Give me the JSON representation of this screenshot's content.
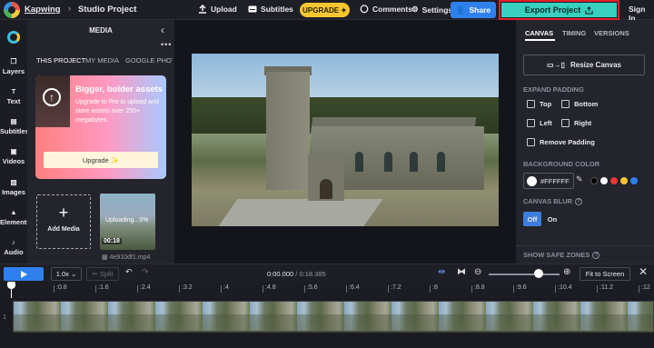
{
  "header": {
    "brand": "Kapwing",
    "project_name": "Studio Project",
    "upload": "Upload",
    "subtitles": "Subtitles",
    "upgrade": "UPGRADE",
    "comments": "Comments",
    "settings": "Settings",
    "share": "Share",
    "export": "Export Project",
    "signin": "Sign In"
  },
  "leftnav": {
    "items": [
      {
        "label": "Layers",
        "icon": "layers-icon"
      },
      {
        "label": "Text",
        "icon": "text-icon"
      },
      {
        "label": "Subtitles",
        "icon": "subtitles-icon"
      },
      {
        "label": "Videos",
        "icon": "videos-icon"
      },
      {
        "label": "Images",
        "icon": "images-icon"
      },
      {
        "label": "Elements",
        "icon": "elements-icon"
      },
      {
        "label": "Audio",
        "icon": "audio-icon"
      }
    ]
  },
  "media": {
    "title": "MEDIA",
    "tabs": [
      "THIS PROJECT",
      "MY MEDIA",
      "GOOGLE PHOTO"
    ],
    "promo_title": "Bigger, bolder assets",
    "promo_text": "Upgrade to Pro to upload and store assets over 250+ megabytes.",
    "promo_button": "Upgrade ✨",
    "add_media": "Add Media",
    "uploading": "Uploading...0%",
    "duration": "00:18",
    "filename": "4e910df1.mp4"
  },
  "right": {
    "tabs": [
      "CANVAS",
      "TIMING",
      "VERSIONS"
    ],
    "resize": "Resize Canvas",
    "expand_padding": "EXPAND PADDING",
    "top": "Top",
    "bottom": "Bottom",
    "left": "Left",
    "right": "Right",
    "remove_padding": "Remove Padding",
    "background_color": "BACKGROUND COLOR",
    "bg_hex": "#FFFFFF",
    "swatches": [
      "#000000",
      "#ffffff",
      "#e53935",
      "#f6c630",
      "#2f80ed"
    ],
    "canvas_blur": "CANVAS BLUR",
    "off": "Off",
    "on": "On",
    "show_safe_zones": "SHOW SAFE ZONES"
  },
  "timeline": {
    "speed": "1.0x",
    "split": "Split",
    "current": "0:00.000",
    "total": "/ 0:18.385",
    "fit": "Fit to Screen",
    "track_number": "1",
    "ticks": [
      ":0.8",
      ":1.6",
      ":2.4",
      ":3.2",
      ":4",
      ":4.8",
      ":5.6",
      ":6.4",
      ":7.2",
      ":8",
      ":8.8",
      ":9.6",
      ":10.4",
      ":11.2",
      ":12"
    ],
    "zoom_level": 0.7
  }
}
